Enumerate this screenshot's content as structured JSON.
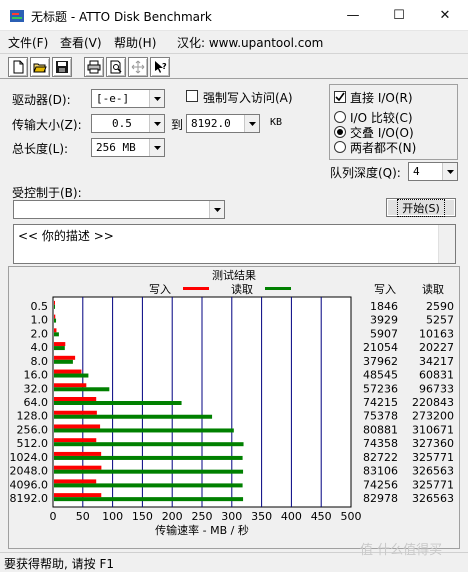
{
  "window": {
    "title": "无标题 - ATTO Disk Benchmark",
    "min_glyph": "—",
    "max_glyph": "☐",
    "close_glyph": "✕"
  },
  "menu": {
    "file": "文件(F)",
    "view": "查看(V)",
    "help": "帮助(H)",
    "localized": "汉化: www.upantool.com"
  },
  "toolbar": {
    "icons": [
      "new-icon",
      "open-icon",
      "save-icon",
      "print-icon",
      "print-preview-icon",
      "move-icon",
      "help-pointer-icon"
    ]
  },
  "form": {
    "drive_label": "驱动器(D):",
    "drive_value": "[-e-]",
    "force_write_label": "强制写入访问(A)",
    "transfer_label": "传输大小(Z):",
    "transfer_from": "0.5",
    "to_label": "到",
    "transfer_to": "8192.0",
    "kb_label": "KB",
    "length_label": "总长度(L):",
    "length_value": "256 MB",
    "direct_io_label": "直接 I/O(R)",
    "direct_io_checked": true,
    "io_compare_label": "I/O 比较(C)",
    "overlap_io_label": "交叠 I/O(O)",
    "neither_label": "两者都不(N)",
    "selected_mode": "overlap",
    "queue_label": "队列深度(Q):",
    "queue_value": "4",
    "controlled_by_label": "受控制于(B):",
    "controlled_by_value": "",
    "start_button": "开始(S)",
    "description_text": "<<   你的描述   >>"
  },
  "chart_data": {
    "type": "bar",
    "title": "测试结果",
    "legend": [
      {
        "name": "写入",
        "color": "#ff0000"
      },
      {
        "name": "读取",
        "color": "#008000"
      }
    ],
    "xlabel": "传输速率 - MB / 秒",
    "xlim": [
      0,
      500
    ],
    "xticks": [
      0,
      50,
      100,
      150,
      200,
      250,
      300,
      350,
      400,
      450,
      500
    ],
    "categories": [
      "0.5",
      "1.0",
      "2.0",
      "4.0",
      "8.0",
      "16.0",
      "32.0",
      "64.0",
      "128.0",
      "256.0",
      "512.0",
      "1024.0",
      "2048.0",
      "4096.0",
      "8192.0"
    ],
    "series": [
      {
        "name": "写入",
        "color": "#ff0000",
        "values": [
          1.8,
          3.8,
          5.8,
          20.6,
          37.1,
          47.7,
          55.9,
          72.5,
          73.6,
          79.0,
          72.6,
          80.8,
          81.2,
          72.5,
          81.0
        ]
      },
      {
        "name": "读取",
        "color": "#008000",
        "values": [
          2.5,
          5.1,
          9.9,
          19.8,
          33.4,
          59.4,
          94.5,
          215.7,
          266.9,
          303.4,
          319.7,
          318.1,
          318.9,
          318.1,
          318.9
        ]
      }
    ],
    "table_headers": {
      "write": "写入",
      "read": "读取"
    },
    "write_col": [
      "1846",
      "3929",
      "5907",
      "21054",
      "37962",
      "48545",
      "57236",
      "74215",
      "75378",
      "80881",
      "74358",
      "82722",
      "83106",
      "74256",
      "82978"
    ],
    "read_col": [
      "2590",
      "5257",
      "10163",
      "20227",
      "34217",
      "60831",
      "96733",
      "220843",
      "273200",
      "310671",
      "327360",
      "325771",
      "326563",
      "325771",
      "326563"
    ]
  },
  "status": {
    "text": "要获得帮助, 请按 F1",
    "watermark": "值 什么值得买"
  }
}
